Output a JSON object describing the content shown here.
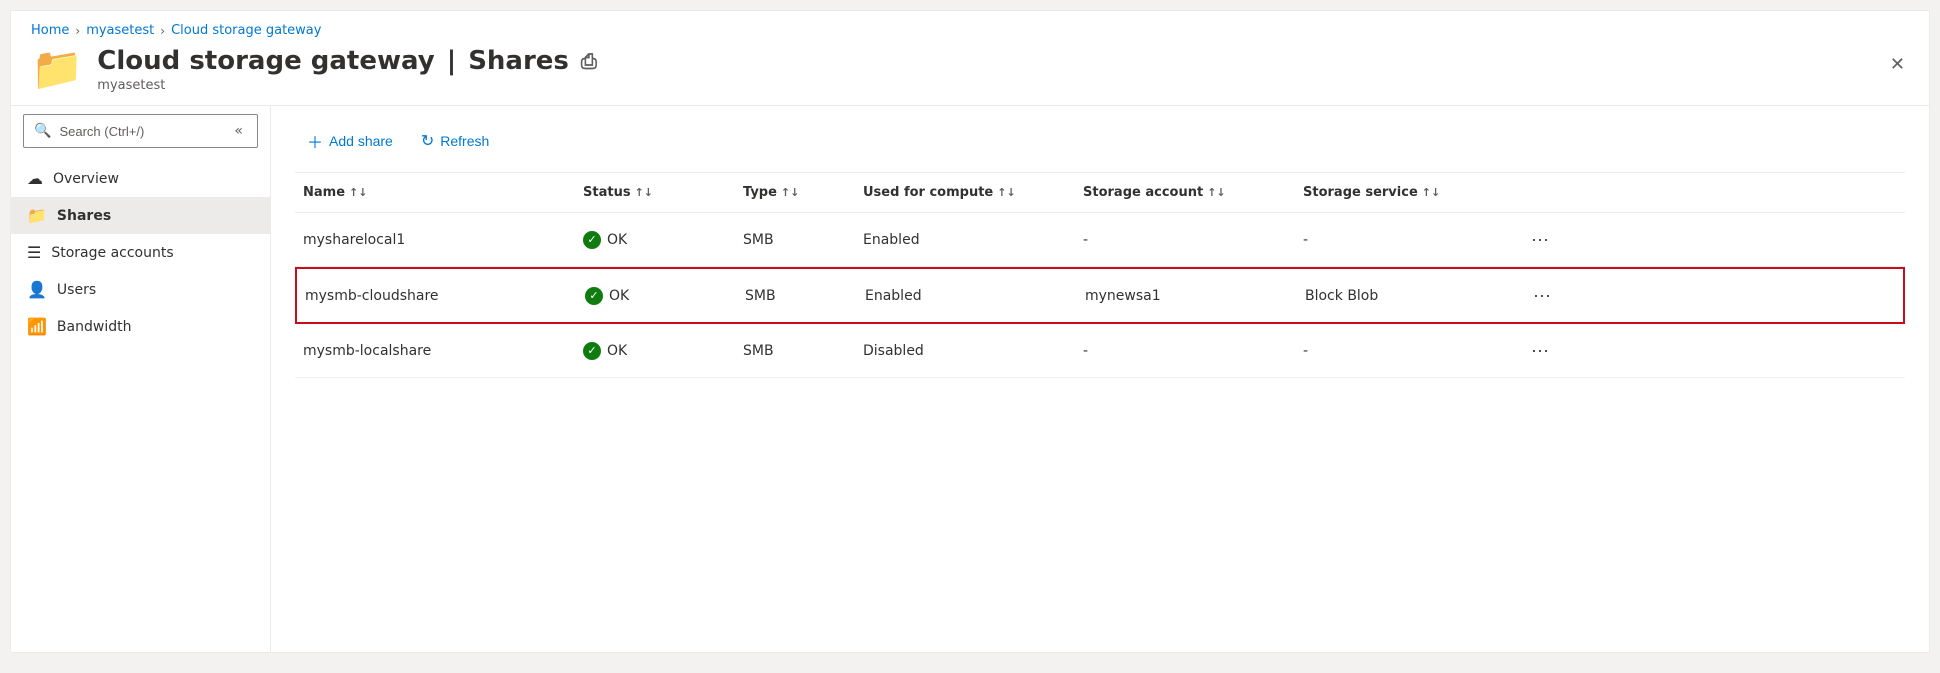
{
  "breadcrumb": {
    "home": "Home",
    "myasetest": "myasetest",
    "cloudgateway": "Cloud storage gateway"
  },
  "header": {
    "title": "Cloud storage gateway",
    "separator": "|",
    "section": "Shares",
    "subtitle": "myasetest"
  },
  "search": {
    "placeholder": "Search (Ctrl+/)"
  },
  "sidebar": {
    "collapse_label": "«",
    "items": [
      {
        "id": "overview",
        "label": "Overview",
        "icon": "☁"
      },
      {
        "id": "shares",
        "label": "Shares",
        "icon": "📁",
        "active": true
      },
      {
        "id": "storage-accounts",
        "label": "Storage accounts",
        "icon": "☰"
      },
      {
        "id": "users",
        "label": "Users",
        "icon": "👤"
      },
      {
        "id": "bandwidth",
        "label": "Bandwidth",
        "icon": "📶"
      }
    ]
  },
  "toolbar": {
    "add_share": "Add share",
    "refresh": "Refresh"
  },
  "table": {
    "columns": [
      {
        "id": "name",
        "label": "Name"
      },
      {
        "id": "status",
        "label": "Status"
      },
      {
        "id": "type",
        "label": "Type"
      },
      {
        "id": "used_for_compute",
        "label": "Used for compute"
      },
      {
        "id": "storage_account",
        "label": "Storage account"
      },
      {
        "id": "storage_service",
        "label": "Storage service"
      },
      {
        "id": "actions",
        "label": ""
      }
    ],
    "rows": [
      {
        "name": "mysharelocal1",
        "status": "OK",
        "type": "SMB",
        "used_for_compute": "Enabled",
        "storage_account": "-",
        "storage_service": "-",
        "highlighted": false
      },
      {
        "name": "mysmb-cloudshare",
        "status": "OK",
        "type": "SMB",
        "used_for_compute": "Enabled",
        "storage_account": "mynewsa1",
        "storage_service": "Block Blob",
        "highlighted": true
      },
      {
        "name": "mysmb-localshare",
        "status": "OK",
        "type": "SMB",
        "used_for_compute": "Disabled",
        "storage_account": "-",
        "storage_service": "-",
        "highlighted": false
      }
    ]
  }
}
